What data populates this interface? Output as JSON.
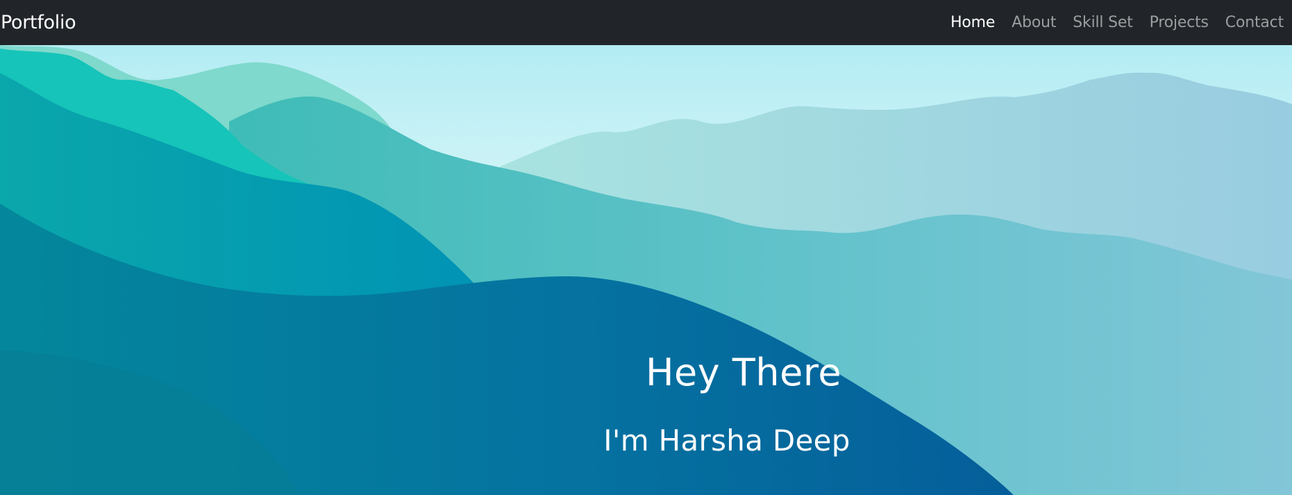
{
  "navbar": {
    "brand": "Portfolio",
    "links": [
      {
        "label": "Home",
        "active": true
      },
      {
        "label": "About",
        "active": false
      },
      {
        "label": "Skill Set",
        "active": false
      },
      {
        "label": "Projects",
        "active": false
      },
      {
        "label": "Contact",
        "active": false
      }
    ]
  },
  "hero": {
    "title": "Hey There",
    "subtitle": "I'm Harsha Deep"
  },
  "colors": {
    "navbar_bg": "#212529",
    "nav_active": "#ffffff",
    "nav_inactive": "#9a9da0",
    "sky_top": "#b3ecf3",
    "mountain_teal": "#22c3b8",
    "mountain_deep": "#066ea3"
  }
}
